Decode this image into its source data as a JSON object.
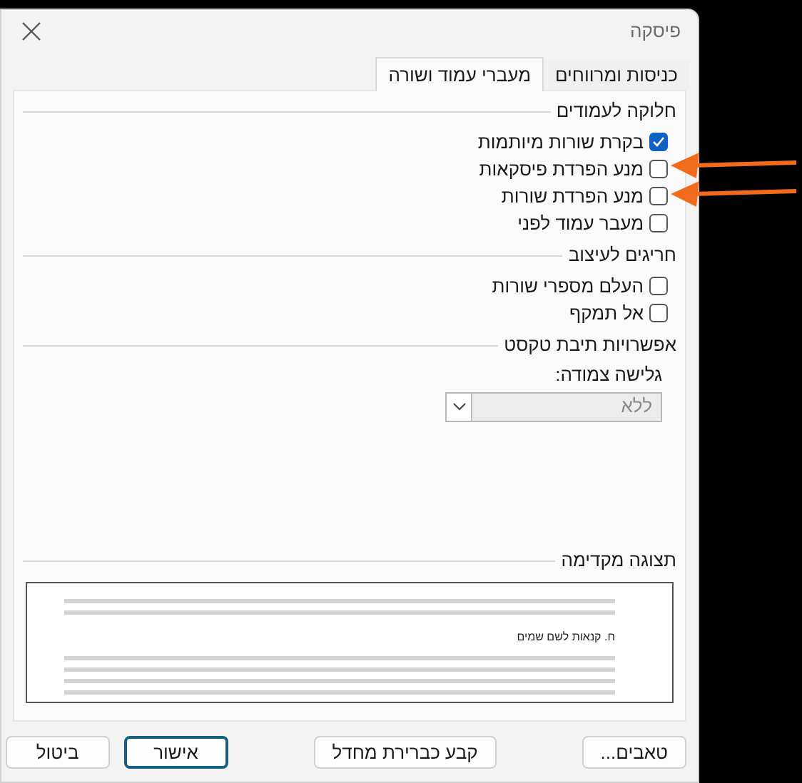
{
  "window": {
    "title": "פיסקה"
  },
  "tabs": [
    {
      "label": "כניסות ומרווחים",
      "selected": false
    },
    {
      "label": "מעברי עמוד ושורה",
      "selected": true
    }
  ],
  "sections": [
    {
      "title": "חלוקה לעמודים",
      "items": [
        {
          "label": "בקרת שורות מיותמות",
          "checked": true
        },
        {
          "label": "מנע הפרדת פיסקאות",
          "checked": false
        },
        {
          "label": "מנע הפרדת שורות",
          "checked": false
        },
        {
          "label": "מעבר עמוד לפני",
          "checked": false
        }
      ]
    },
    {
      "title": "חריגים לעיצוב",
      "items": [
        {
          "label": "העלם מספרי שורות",
          "checked": false
        },
        {
          "label": "אל תמקף",
          "checked": false
        }
      ]
    }
  ],
  "textbox_options": {
    "title": "אפשרויות תיבת טקסט",
    "field_label": "גלישה צמודה:",
    "select": {
      "value": "ללא",
      "disabled": true
    }
  },
  "preview": {
    "title": "תצוגה מקדימה",
    "heading": "ח. קנאות לשם שמים"
  },
  "buttons": [
    {
      "label": "טאבים...",
      "kind": "normal"
    },
    {
      "label": "קבע כברירת מחדל",
      "kind": "normal"
    },
    {
      "label": "אישור",
      "kind": "default"
    },
    {
      "label": "ביטול",
      "kind": "normal"
    }
  ]
}
